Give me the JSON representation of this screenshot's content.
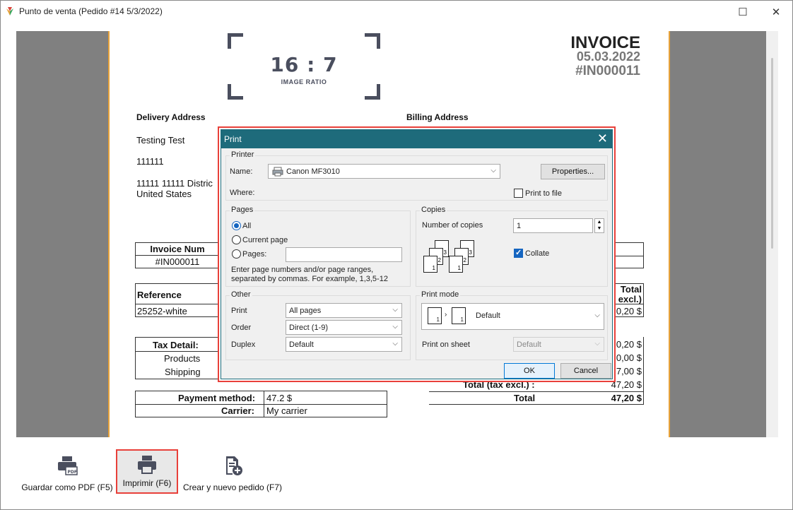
{
  "window": {
    "title": "Punto de venta (Pedido #14 5/3/2022)",
    "maximize_glyph": "☐",
    "close_glyph": "✕"
  },
  "invoice": {
    "placeholder_ratio": "16 : 7",
    "placeholder_sub": "IMAGE RATIO",
    "title": "INVOICE",
    "date": "05.03.2022",
    "number": "#IN000011",
    "delivery_label": "Delivery Address",
    "billing_label": "Billing Address",
    "customer_name": "Testing Test",
    "phone": "111111",
    "address_line1": "11111 11111 Distric",
    "address_line2": "United States",
    "invoice_number_header": "Invoice Num",
    "invoice_number_value": "#IN000011",
    "reference_header": "Reference",
    "reference_value": "25252-white",
    "total_header_1": "Total",
    "total_header_2": "excl.)",
    "total_value": "0,20 $",
    "tax_detail": "Tax Detail:",
    "tax_products": "Products",
    "tax_shipping": "Shipping",
    "right_values": [
      "0,20 $",
      "0,00 $",
      "7,00 $"
    ],
    "total_tax_excl_label": "Total (tax excl.) :",
    "total_tax_excl_value": "47,20 $",
    "grand_total_label": "Total",
    "grand_total_value": "47,20 $",
    "payment_label": "Payment method:",
    "payment_value": "47.2 $",
    "carrier_label": "Carrier:",
    "carrier_value": "My carrier"
  },
  "print_dialog": {
    "title": "Print",
    "printer_group": "Printer",
    "name_label": "Name:",
    "printer_name": "Canon MF3010",
    "properties_button": "Properties...",
    "where_label": "Where:",
    "print_to_file": "Print to file",
    "print_to_file_checked": false,
    "pages_group": "Pages",
    "pages_options": [
      "All",
      "Current page",
      "Pages:"
    ],
    "pages_selected": "All",
    "pages_hint_1": "Enter page numbers and/or page ranges,",
    "pages_hint_2": "separated by commas. For example, 1,3,5-12",
    "copies_group": "Copies",
    "number_of_copies_label": "Number of copies",
    "number_of_copies": "1",
    "collate_label": "Collate",
    "collate_checked": true,
    "other_group": "Other",
    "print_label": "Print",
    "print_value": "All pages",
    "order_label": "Order",
    "order_value": "Direct (1-9)",
    "duplex_label": "Duplex",
    "duplex_value": "Default",
    "print_mode_group": "Print mode",
    "print_mode_value": "Default",
    "print_on_sheet_label": "Print on sheet",
    "print_on_sheet_value": "Default",
    "ok_button": "OK",
    "cancel_button": "Cancel"
  },
  "toolbar": {
    "save_pdf_label": "Guardar como PDF (F5)",
    "print_label": "Imprimir (F6)",
    "new_order_label": "Crear y nuevo pedido (F7)"
  },
  "colors": {
    "dialog_title_bar": "#1e6b7b",
    "highlight_border": "#e8403a",
    "page_margin": "#e8a33a",
    "viewer_bg": "#808080"
  }
}
